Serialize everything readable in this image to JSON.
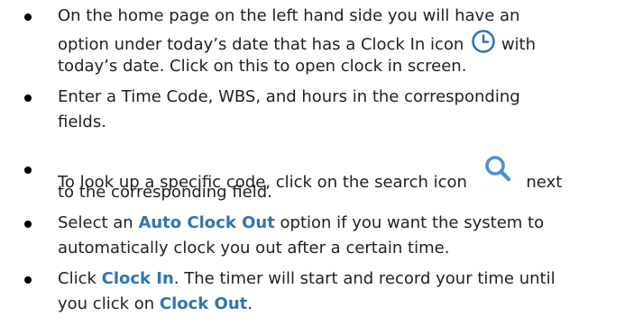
{
  "instructions": {
    "item1": {
      "line1": "On the home page on the left hand side you will have an",
      "line2_pre": "option under today’s date that has a Clock In icon",
      "line2_post": "with",
      "line3": "today’s date. Click on this to open clock in screen."
    },
    "item2": {
      "line1": "Enter a Time Code, WBS, and hours in the corresponding",
      "line2": "fields."
    },
    "item3": {
      "line1_pre": "To look up a specific code, click on the search icon",
      "line1_post": "next",
      "line2": "to the corresponding field."
    },
    "item4": {
      "line1_pre": "Select an",
      "line1_kw": "Auto Clock Out",
      "line1_post": "option if you want the system to",
      "line2": "automatically clock you out after a certain time."
    },
    "item5": {
      "line1_pre": "Click",
      "line1_kw": "Clock In",
      "line1_post": ". The timer will start and record your time until",
      "line2_pre": "you click on",
      "line2_kw": "Clock Out",
      "line2_post": "."
    }
  },
  "colors": {
    "keyword": "#2e75b6",
    "clock_icon": "#2e75b6",
    "search_icon": "#4a90d9"
  },
  "icons": {
    "clock": "clock-icon",
    "search": "search-icon"
  }
}
